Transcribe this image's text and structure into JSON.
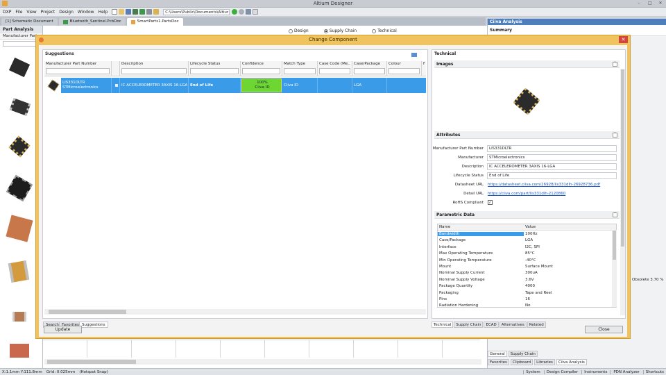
{
  "app": {
    "title": "Altium Designer",
    "menu": [
      "DXP",
      "File",
      "View",
      "Project",
      "Design",
      "Window",
      "Help"
    ],
    "path": "C:\\Users\\Public\\Documents\\Altiur"
  },
  "doc_tabs": [
    {
      "label": "[1] Schematic Document",
      "active": false
    },
    {
      "label": "Bluetooth_Sentinel.PcbDoc",
      "active": false
    },
    {
      "label": "SmartParts1.PartsDoc",
      "active": true
    }
  ],
  "left_panel": {
    "title": "Part Analysis",
    "input_label": "Manufacturer Part"
  },
  "mode_radios": [
    {
      "label": "Design",
      "checked": false
    },
    {
      "label": "Supply Chain",
      "checked": true
    },
    {
      "label": "Technical",
      "checked": false
    }
  ],
  "dialog": {
    "title": "Change Component",
    "suggestions_title": "Suggestions",
    "columns": [
      "Manufacturer Part Number",
      "Description",
      "Lifecycle Status",
      "Confidence",
      "Match Type",
      "Case Code (Me...",
      "Case/Package",
      "Colour",
      "F"
    ],
    "row": {
      "mpn": "LIS331DLTR",
      "manufacturer": "STMicroelectronics",
      "description": "IC ACCELEROMETER 3AXIS 16-LGA",
      "lifecycle": "End of Life",
      "confidence_pct": "100%",
      "confidence_src": "Ciiva ID",
      "match_type": "Ciiva ID",
      "case_package": "LGA"
    },
    "left_tabs": [
      "Search",
      "Favorites",
      "Suggestions"
    ],
    "update_label": "Update",
    "close_label": "Close"
  },
  "technical": {
    "title": "Technical",
    "images_label": "Images",
    "attributes_label": "Attributes",
    "attributes": [
      {
        "key": "Manufacturer Part Number",
        "value": "LIS331DLTR",
        "type": "box"
      },
      {
        "key": "Manufacturer",
        "value": "STMicroelectronics",
        "type": "box"
      },
      {
        "key": "Description",
        "value": "IC ACCELEROMETER 3AXIS 16-LGA",
        "type": "box"
      },
      {
        "key": "Lifecycle Status",
        "value": "End of Life",
        "type": "box"
      },
      {
        "key": "Datasheet URL",
        "value": "https://datasheet.ciiva.com/26928/lis331dlh-26928736.pdf",
        "type": "link"
      },
      {
        "key": "Detail URL",
        "value": "https://ciiva.com/part/lis331dlh-2120860",
        "type": "link"
      },
      {
        "key": "RoHS Compliant",
        "value": "✓",
        "type": "check"
      }
    ],
    "parametric_label": "Parametric Data",
    "param_headers": {
      "name": "Name",
      "value": "Value"
    },
    "params": [
      {
        "name": "Bandwidth",
        "value": "100Hz"
      },
      {
        "name": "Case/Package",
        "value": "LGA"
      },
      {
        "name": "Interface",
        "value": "I2C, SPI"
      },
      {
        "name": "Max Operating Temperature",
        "value": "85°C"
      },
      {
        "name": "Min Operating Temperature",
        "value": "-40°C"
      },
      {
        "name": "Mount",
        "value": "Surface Mount"
      },
      {
        "name": "Nominal Supply Current",
        "value": "300uA"
      },
      {
        "name": "Nominal Supply Voltage",
        "value": "3.6V"
      },
      {
        "name": "Package Quantity",
        "value": "4000"
      },
      {
        "name": "Packaging",
        "value": "Tape and Reel"
      },
      {
        "name": "Pins",
        "value": "16"
      },
      {
        "name": "Radiation Hardening",
        "value": "No"
      }
    ],
    "bottom_tabs": [
      "Technical",
      "Supply Chain",
      "ECAD",
      "Alternatives",
      "Related"
    ]
  },
  "right_panel": {
    "title": "Ciiva Analysis",
    "summary": "Summary",
    "obsolete_text": "Obsolete 3.70 %",
    "tabs_top": [
      "General",
      "Supply Chain"
    ],
    "tabs_bottom": [
      "Favorites",
      "Clipboard",
      "Libraries",
      "Ciiva Analysis"
    ]
  },
  "status": {
    "coords": "X:1.1mm Y:111.8mm",
    "grid": "Grid: 0.025mm",
    "snap": "(Hotspot Snap)",
    "right_items": [
      "System",
      "Design Compiler",
      "Instruments",
      "PDN Analyzer",
      "Shortcuts"
    ]
  }
}
